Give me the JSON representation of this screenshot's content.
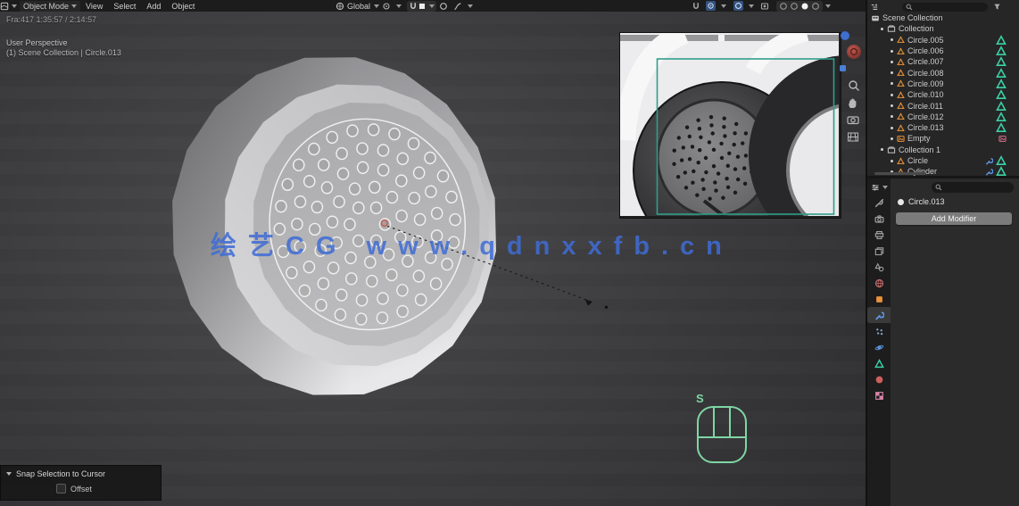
{
  "header": {
    "editor_icon": "viewport-editor-icon",
    "mode_label": "Object Mode",
    "menus": [
      "View",
      "Select",
      "Add",
      "Object"
    ],
    "orientation_label": "Global",
    "center_icons": [
      "transform-orientation-icon",
      "pivot-point-icon",
      "snap-magnet-icon",
      "snap-target-icon",
      "proportional-editing-icon",
      "falloff-icon"
    ],
    "right_icons": [
      "snap-magnet-icon",
      "gizmo-toggle-icon",
      "overlays-toggle-icon",
      "xray-toggle-icon"
    ],
    "shading_modes": [
      "wireframe",
      "solid",
      "material-preview",
      "rendered"
    ],
    "active_shading_index": 2
  },
  "viewport": {
    "stats_line": "Fra:417  1:35:57 / 2:14:57",
    "view_label": "User Perspective",
    "context_label": "(1) Scene Collection | Circle.013",
    "watermark": "绘艺CG  www.qdnxxfb.cn",
    "screencast_key": "S",
    "model": {
      "description": "low-poly headphone ear-cup cylinder with perforated speaker holes",
      "hole_rings": [
        {
          "radius": 0.18,
          "count": 6
        },
        {
          "radius": 0.36,
          "count": 11
        },
        {
          "radius": 0.54,
          "count": 16
        },
        {
          "radius": 0.72,
          "count": 21
        },
        {
          "radius": 0.9,
          "count": 26
        }
      ]
    },
    "nav_icons": [
      "axis-gizmo-blue",
      "axis-gizmo-red",
      "camera-view-dot",
      "zoom-icon",
      "pan-hand-icon",
      "camera-icon",
      "perspective-grid-icon"
    ]
  },
  "redo_panel": {
    "title": "Snap Selection to Cursor",
    "checkbox_label": "Offset",
    "checked": false
  },
  "outliner": {
    "header_icons": [
      "outliner-editor-icon",
      "search-icon",
      "filter-icon"
    ],
    "search_placeholder": "",
    "rows": [
      {
        "indent": 0,
        "icon": "scene-collection",
        "label": "Scene Collection",
        "right": []
      },
      {
        "indent": 1,
        "icon": "collection",
        "label": "Collection",
        "dot": true,
        "right": []
      },
      {
        "indent": 2,
        "icon": "mesh",
        "label": "Circle.005",
        "dot": true,
        "right": [
          "mesh-data"
        ]
      },
      {
        "indent": 2,
        "icon": "mesh",
        "label": "Circle.006",
        "dot": true,
        "right": [
          "mesh-data"
        ]
      },
      {
        "indent": 2,
        "icon": "mesh",
        "label": "Circle.007",
        "dot": true,
        "right": [
          "mesh-data"
        ]
      },
      {
        "indent": 2,
        "icon": "mesh",
        "label": "Circle.008",
        "dot": true,
        "right": [
          "mesh-data"
        ]
      },
      {
        "indent": 2,
        "icon": "mesh",
        "label": "Circle.009",
        "dot": true,
        "right": [
          "mesh-data"
        ]
      },
      {
        "indent": 2,
        "icon": "mesh",
        "label": "Circle.010",
        "dot": true,
        "right": [
          "mesh-data"
        ]
      },
      {
        "indent": 2,
        "icon": "mesh",
        "label": "Circle.011",
        "dot": true,
        "right": [
          "mesh-data"
        ]
      },
      {
        "indent": 2,
        "icon": "mesh",
        "label": "Circle.012",
        "dot": true,
        "right": [
          "mesh-data"
        ]
      },
      {
        "indent": 2,
        "icon": "mesh",
        "label": "Circle.013",
        "dot": true,
        "right": [
          "mesh-data"
        ]
      },
      {
        "indent": 2,
        "icon": "empty-image",
        "label": "Empty",
        "dot": true,
        "right": [
          "image-data"
        ]
      },
      {
        "indent": 1,
        "icon": "collection",
        "label": "Collection 1",
        "dot": true,
        "right": []
      },
      {
        "indent": 2,
        "icon": "mesh",
        "label": "Circle",
        "dot": true,
        "right": [
          "modifier",
          "mesh-data"
        ]
      },
      {
        "indent": 2,
        "icon": "mesh",
        "label": "Cylinder",
        "dot": true,
        "right": [
          "modifier",
          "mesh-data"
        ]
      }
    ]
  },
  "properties": {
    "editor_icon": "properties-editor-icon",
    "search_placeholder": "",
    "breadcrumb": "Circle.013",
    "add_modifier_label": "Add Modifier",
    "tabs": [
      {
        "name": "tool",
        "icon": "tool-icon",
        "color": "#a2a2a2",
        "active": false
      },
      {
        "name": "render",
        "icon": "render-camera-icon",
        "color": "#a2a2a2",
        "active": false
      },
      {
        "name": "output",
        "icon": "printer-icon",
        "color": "#a2a2a2",
        "active": false
      },
      {
        "name": "view-layer",
        "icon": "view-layer-icon",
        "color": "#a2a2a2",
        "active": false
      },
      {
        "name": "scene",
        "icon": "scene-icon",
        "color": "#a2a2a2",
        "active": false
      },
      {
        "name": "world",
        "icon": "world-icon",
        "color": "#c26b6b",
        "active": false
      },
      {
        "name": "object",
        "icon": "object-square-icon",
        "color": "#e8923a",
        "active": false
      },
      {
        "name": "modifiers",
        "icon": "wrench-icon",
        "color": "#5f97e8",
        "active": true
      },
      {
        "name": "particles",
        "icon": "particles-icon",
        "color": "#8fb2dc",
        "active": false
      },
      {
        "name": "physics",
        "icon": "physics-icon",
        "color": "#5a8fd8",
        "active": false
      },
      {
        "name": "object-data",
        "icon": "mesh-data-icon",
        "color": "#3dcfa5",
        "active": false
      },
      {
        "name": "material",
        "icon": "material-sphere-icon",
        "color": "#cf5f5f",
        "active": false
      },
      {
        "name": "texture",
        "icon": "texture-checker-icon",
        "color": "#d884a8",
        "active": false
      }
    ]
  },
  "colors": {
    "accent_blue": "#4a80d4",
    "mesh_orange": "#e8923a",
    "data_teal": "#3dcfa5",
    "image_pink": "#d8708e",
    "watermark_blue": "#3f6cd6",
    "screencast_green": "#7fd6a4",
    "viewport_bg": "#3a3a3c"
  }
}
